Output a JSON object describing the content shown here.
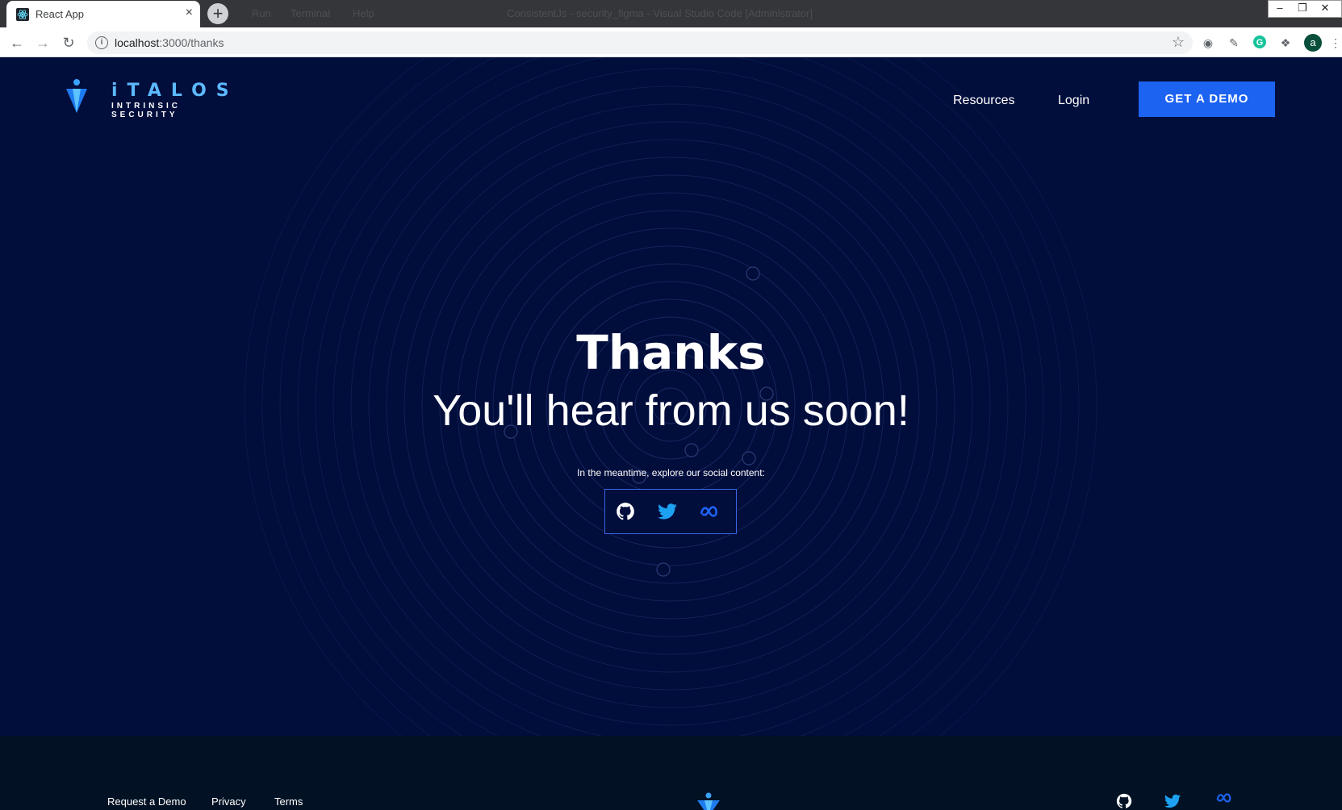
{
  "browser": {
    "tab_title": "React App",
    "tab_close": "×",
    "new_tab": "+",
    "background_menu": [
      "Run",
      "Terminal",
      "Help"
    ],
    "background_window_title": "ConsistentJs - security_figma - Visual Studio Code [Administrator]",
    "url_host": "localhost",
    "url_path": ":3000/thanks",
    "avatar_letter": "a"
  },
  "header": {
    "logo_word": "iTALOS",
    "logo_sub": "INTRINSIC SECURITY",
    "nav": {
      "resources": "Resources",
      "login": "Login"
    },
    "cta": "GET A DEMO"
  },
  "hero": {
    "title": "Thanks",
    "subtitle": "You'll hear from us soon!",
    "meantime": "In the meantime, explore our social content:"
  },
  "social": [
    "github-icon",
    "twitter-icon",
    "meta-icon"
  ],
  "footer": {
    "links": {
      "request_demo": "Request a Demo",
      "privacy": "Privacy",
      "terms": "Terms"
    }
  },
  "colors": {
    "page_bg": "#010d3b",
    "footer_bg": "#021124",
    "accent": "#1c63f1",
    "logo_blue": "#5cb8ff"
  }
}
